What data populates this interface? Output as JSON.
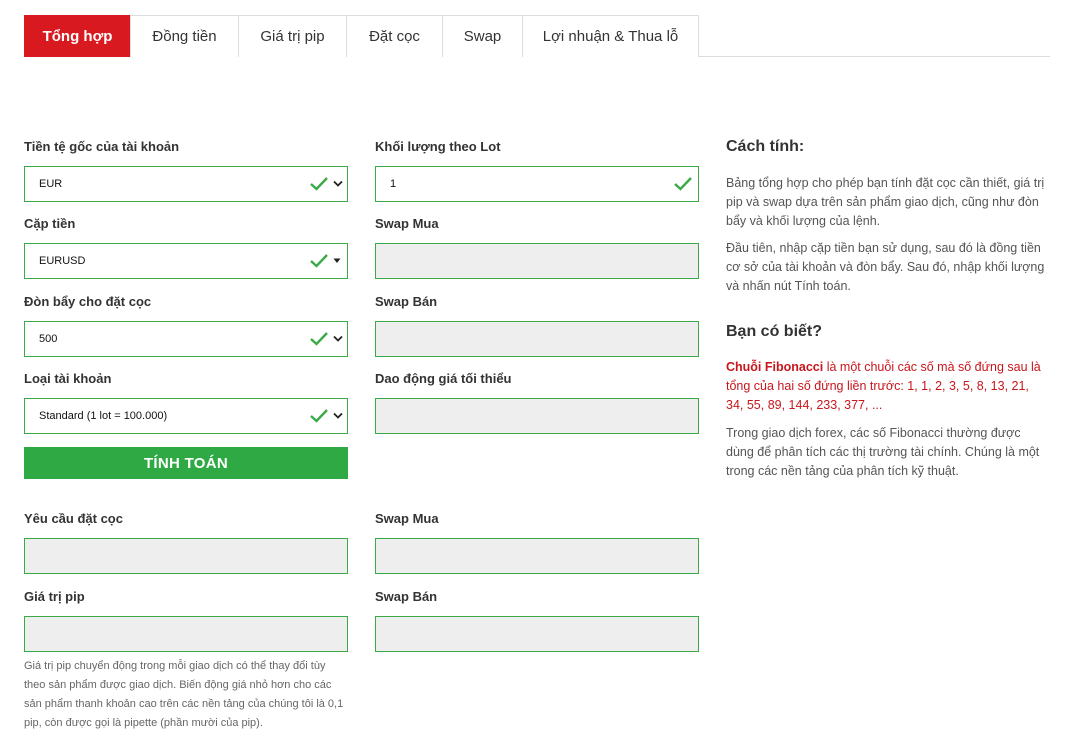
{
  "tabs": [
    {
      "label": "Tổng hợp",
      "active": true
    },
    {
      "label": "Đồng tiền"
    },
    {
      "label": "Giá trị pip"
    },
    {
      "label": "Đặt cọc"
    },
    {
      "label": "Swap"
    },
    {
      "label": "Lợi nhuận & Thua lỗ"
    }
  ],
  "form": {
    "account_currency": {
      "label": "Tiền tệ gốc của tài khoản",
      "value": "EUR"
    },
    "currency_pair": {
      "label": "Cặp tiền",
      "value": "EURUSD"
    },
    "leverage": {
      "label": "Đòn bẩy cho đặt cọc",
      "value": "500"
    },
    "account_type": {
      "label": "Loại tài khoản",
      "value": "Standard (1 lot = 100.000)"
    },
    "lot_volume": {
      "label": "Khối lượng theo Lot",
      "value": "1"
    },
    "swap_buy": {
      "label": "Swap Mua",
      "value": ""
    },
    "swap_sell": {
      "label": "Swap Bán",
      "value": ""
    },
    "min_fluctuation": {
      "label": "Dao động giá tối thiểu",
      "value": ""
    },
    "calculate_label": "TÍNH TOÁN"
  },
  "results": {
    "margin_required": {
      "label": "Yêu cầu đặt cọc",
      "value": ""
    },
    "swap_buy": {
      "label": "Swap Mua",
      "value": ""
    },
    "pip_value": {
      "label": "Giá trị pip",
      "value": ""
    },
    "swap_sell": {
      "label": "Swap Bán",
      "value": ""
    },
    "note": "Giá trị pip chuyển động trong mỗi giao dịch có thể thay đổi tùy theo sản phẩm được giao dịch. Biến động giá nhỏ hơn cho các sản phẩm thanh khoản cao trên các nền tảng của chúng tôi là 0,1 pip, còn được gọi là pipette (phần mười của pip)."
  },
  "sidebar": {
    "how_title": "Cách tính:",
    "how_p1": "Bảng tổng hợp cho phép bạn tính đặt cọc cần thiết, giá trị pip và swap dựa trên sản phẩm giao dịch, cũng như đòn bẩy và khối lượng của lệnh.",
    "how_p2": "Đầu tiên, nhập cặp tiền bạn sử dụng, sau đó là đồng tiền cơ sở của tài khoản và đòn bẩy. Sau đó, nhập khối lượng và nhấn nút Tính toán.",
    "know_title": "Bạn có biết?",
    "fib_term": "Chuỗi Fibonacci",
    "fib_text": " là một chuỗi các số mà số đứng sau là tổng của hai số đứng liền trước: 1, 1, 2, 3, 5, 8, 13, 21, 34, 55, 89, 144, 233, 377, ...",
    "forex_p": "Trong giao dịch forex, các số Fibonacci thường được dùng để phân tích các thị trường tài chính. Chúng là một trong các nền tảng của phân tích kỹ thuật."
  },
  "colors": {
    "accent": "#d8191f",
    "valid": "#3aa946",
    "button": "#2fa943"
  }
}
